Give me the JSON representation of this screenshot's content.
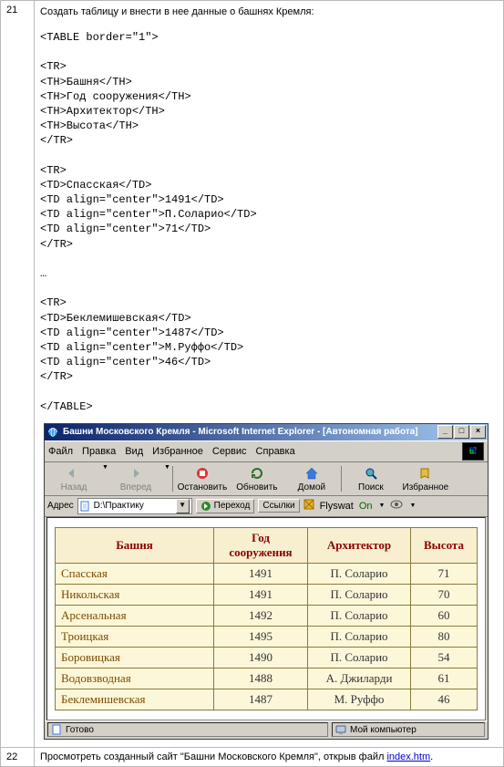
{
  "row21": {
    "num": "21",
    "task": "Создать таблицу и внести в нее данные о башнях Кремля:",
    "code1": "<TABLE border=\"1\">\n\n<TR>\n<TH>Башня</TH>\n<TH>Год сооружения</TH>\n<TH>Архитектор</TH>\n<TH>Высота</TH>\n</TR>\n\n<TR>\n<TD>Спасская</TD>\n<TD align=\"center\">1491</TD>\n<TD align=\"center\">П.Соларио</TD>\n<TD align=\"center\">71</TD>\n</TR>\n\n…\n\n<TR>\n<TD>Беклемишевская</TD>\n<TD align=\"center\">1487</TD>\n<TD align=\"center\">М.Руффо</TD>\n<TD align=\"center\">46</TD>\n</TR>\n\n</TABLE>"
  },
  "ie": {
    "title": "Башни Московского Кремля - Microsoft Internet Explorer - [Автономная работа]",
    "menus": [
      "Файл",
      "Правка",
      "Вид",
      "Избранное",
      "Сервис",
      "Справка"
    ],
    "toolbar": {
      "back": "Назад",
      "forward": "Вперед",
      "stop": "Остановить",
      "refresh": "Обновить",
      "home": "Домой",
      "search": "Поиск",
      "favorites": "Избранное"
    },
    "address": {
      "label": "Адрес",
      "value": "D:\\Практику",
      "go": "Переход",
      "links": "Ссылки",
      "flyswat_label": "Flyswat",
      "flyswat_state": "On"
    },
    "status": {
      "left": "Готово",
      "right": "Мой компьютер"
    }
  },
  "chart_data": {
    "type": "table",
    "title": "Башни Московского Кремля",
    "columns": [
      "Башня",
      "Год сооружения",
      "Архитектор",
      "Высота"
    ],
    "rows": [
      [
        "Спасская",
        "1491",
        "П. Соларио",
        "71"
      ],
      [
        "Никольская",
        "1491",
        "П. Соларио",
        "70"
      ],
      [
        "Арсенальная",
        "1492",
        "П. Соларио",
        "60"
      ],
      [
        "Троицкая",
        "1495",
        "П. Соларио",
        "80"
      ],
      [
        "Боровицкая",
        "1490",
        "П. Соларио",
        "54"
      ],
      [
        "Водовзводная",
        "1488",
        "А. Джиларди",
        "61"
      ],
      [
        "Беклемишевская",
        "1487",
        "М. Руффо",
        "46"
      ]
    ]
  },
  "row22": {
    "num": "22",
    "text_before": "Просмотреть созданный сайт \"Башни Московского Кремля\", открыв файл ",
    "link_text": "index.htm",
    "text_after": "."
  }
}
